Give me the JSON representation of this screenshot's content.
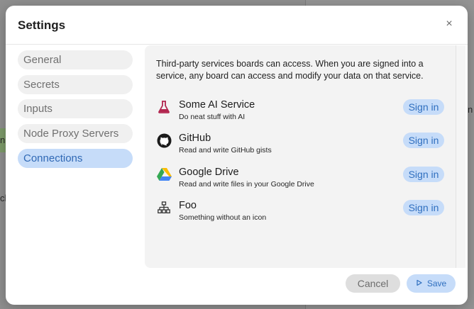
{
  "dialog": {
    "title": "Settings",
    "close_glyph": "×"
  },
  "sidebar": {
    "items": [
      {
        "label": "General",
        "active": false
      },
      {
        "label": "Secrets",
        "active": false
      },
      {
        "label": "Inputs",
        "active": false
      },
      {
        "label": "Node Proxy Servers",
        "active": false
      },
      {
        "label": "Connections",
        "active": true
      }
    ]
  },
  "connections": {
    "intro": "Third-party services boards can access. When you are signed into a service, any board can access and modify your data on that service.",
    "services": [
      {
        "name": "Some AI Service",
        "description": "Do neat stuff with AI",
        "icon": "flask-icon",
        "button": "Sign in"
      },
      {
        "name": "GitHub",
        "description": "Read and write GitHub gists",
        "icon": "github-icon",
        "button": "Sign in"
      },
      {
        "name": "Google Drive",
        "description": "Read and write files in your Google Drive",
        "icon": "google-drive-icon",
        "button": "Sign in"
      },
      {
        "name": "Foo",
        "description": "Something without an icon",
        "icon": "network-icon",
        "button": "Sign in"
      }
    ]
  },
  "footer": {
    "cancel_label": "Cancel",
    "save_label": "Save"
  },
  "background": {
    "fragment_left_1": "np",
    "fragment_left_2": "ch",
    "fragment_right": "n"
  },
  "colors": {
    "accent_bg": "#c6dcf9",
    "accent_text": "#2f6fbf",
    "flask": "#b2264f"
  }
}
